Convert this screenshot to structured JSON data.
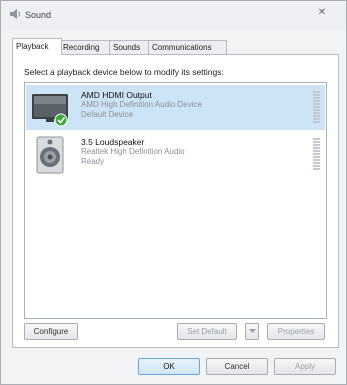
{
  "window": {
    "title": "Sound",
    "close_glyph": "✕"
  },
  "tabs": [
    {
      "label": "Playback",
      "active": true
    },
    {
      "label": "Recording",
      "active": false
    },
    {
      "label": "Sounds",
      "active": false
    },
    {
      "label": "Communications",
      "active": false
    }
  ],
  "playback": {
    "instruction": "Select a playback device below to modify its settings:",
    "devices": [
      {
        "name": "AMD HDMI Output",
        "driver": "AMD High Definition Audio Device",
        "status": "Default Device",
        "selected": true,
        "icon": "monitor-icon"
      },
      {
        "name": "3.5 Loudspeaker",
        "driver": "Realtek High Definition Audio",
        "status": "Ready",
        "selected": false,
        "icon": "speaker-icon"
      }
    ]
  },
  "buttons": {
    "configure": "Configure",
    "set_default": "Set Default",
    "properties": "Properties",
    "ok": "OK",
    "cancel": "Cancel",
    "apply": "Apply"
  },
  "colors": {
    "selection": "#cde4f7",
    "check": "#3aa93a"
  }
}
